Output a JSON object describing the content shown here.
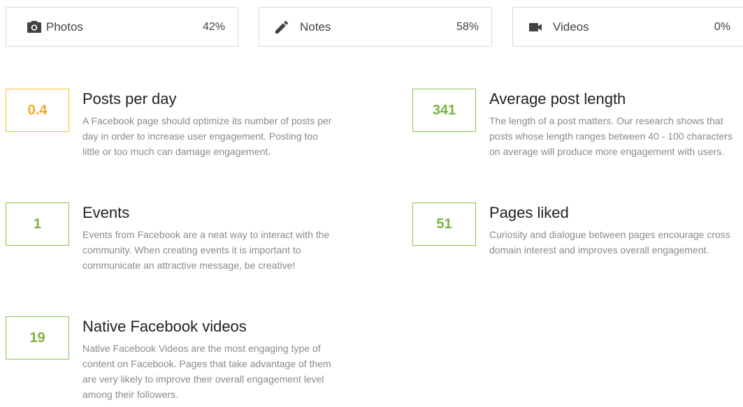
{
  "content_types": [
    {
      "label": "Photos",
      "percent": "42%",
      "icon": "camera-icon"
    },
    {
      "label": "Notes",
      "percent": "58%",
      "icon": "pencil-icon"
    },
    {
      "label": "Videos",
      "percent": "0%",
      "icon": "video-camera-icon"
    }
  ],
  "metrics": {
    "posts_per_day": {
      "value": "0.4",
      "title": "Posts per day",
      "description": "A Facebook page should optimize its number of posts per day in order to increase user engagement. Posting too little or too much can damage engagement.",
      "status_color": "#f9a825"
    },
    "avg_post_length": {
      "value": "341",
      "title": "Average post length",
      "description": "The length of a post matters. Our research shows that posts whose length ranges between 40 - 100 characters on average will produce more engagement with users.",
      "status_color": "#7cb342"
    },
    "events": {
      "value": "1",
      "title": "Events",
      "description": "Events from Facebook are a neat way to interact with the community. When creating events it is important to communicate an attractive message, be creative!",
      "status_color": "#7cb342"
    },
    "pages_liked": {
      "value": "51",
      "title": "Pages liked",
      "description": "Curiosity and dialogue between pages encourage cross domain interest and improves overall engagement.",
      "status_color": "#7cb342"
    },
    "native_videos": {
      "value": "19",
      "title": "Native Facebook videos",
      "description": "Native Facebook Videos are the most engaging type of content on Facebook. Pages that take advantage of them are very likely to improve their overall engagement level among their followers.",
      "status_color": "#7cb342"
    }
  },
  "colors": {
    "good": "#7cb342",
    "warning": "#f9a825",
    "icon": "#424242"
  }
}
